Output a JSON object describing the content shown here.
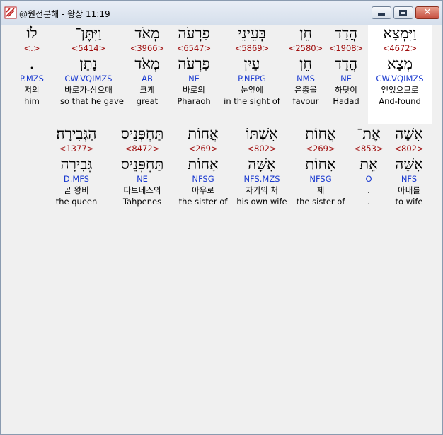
{
  "window": {
    "title": "@원전분해 - 왕상 11:19"
  },
  "lines": [
    {
      "words": [
        {
          "heb": "וַיִּמְצָא",
          "num": "<4672>",
          "root": "מְצָא",
          "gram": "CW.VQIMZS",
          "kor": "얻었으므로",
          "eng": "And-found",
          "highlight": true
        },
        {
          "heb": "הֲדַד",
          "num": "<1908>",
          "root": "הֲדַד",
          "gram": "NE",
          "kor": "하닷이",
          "eng": "Hadad"
        },
        {
          "heb": "חֵן",
          "num": "<2580>",
          "root": "חֵן",
          "gram": "NMS",
          "kor": "은총을",
          "eng": "favour"
        },
        {
          "heb": "בְּעֵינֵי",
          "num": "<5869>",
          "root": "עַיִן",
          "gram": "P.NFPG",
          "kor": "눈앞에",
          "eng": "in the sight of"
        },
        {
          "heb": "פַרְעֹה",
          "num": "<6547>",
          "root": "פַרְעֹה",
          "gram": "NE",
          "kor": "바로의",
          "eng": "Pharaoh"
        },
        {
          "heb": "מְאֹד",
          "num": "<3966>",
          "root": "מְאֹד",
          "gram": "AB",
          "kor": "크게",
          "eng": "great"
        },
        {
          "heb": "וַיִּתֶּן־",
          "num": "<5414>",
          "root": "נָתַן",
          "gram": "CW.VQIMZS",
          "kor": "바로가-삼으매",
          "eng": "so that he gave"
        },
        {
          "heb": "לוֹ",
          "num": "<.>",
          "root": ".",
          "gram": "P.MZS",
          "kor": "저의",
          "eng": "him"
        }
      ]
    },
    {
      "words": [
        {
          "heb": "אִשָּׁה",
          "num": "<802>",
          "root": "אִשָּׁה",
          "gram": "NFS",
          "kor": "아내를",
          "eng": "to wife"
        },
        {
          "heb": "אֶת־",
          "num": "<853>",
          "root": "אֵת",
          "gram": "O",
          "kor": ".",
          "eng": "."
        },
        {
          "heb": "אֲחוֹת",
          "num": "<269>",
          "root": "אָחוֹת",
          "gram": "NFSG",
          "kor": "제",
          "eng": "the sister of"
        },
        {
          "heb": "אִשְׁתּוֹ",
          "num": "<802>",
          "root": "אִשָּׁה",
          "gram": "NFS.MZS",
          "kor": "자기의 처",
          "eng": "his own wife"
        },
        {
          "heb": "אֲחוֹת",
          "num": "<269>",
          "root": "אָחוֹת",
          "gram": "NFSG",
          "kor": "아우로",
          "eng": "the sister of"
        },
        {
          "heb": "תַּחְפְּנֵיס",
          "num": "<8472>",
          "root": "תַּחְפְּנֵיס",
          "gram": "NE",
          "kor": "다브네스의",
          "eng": "Tahpenes"
        },
        {
          "heb": "הַגְּבִירָה׃",
          "num": "<1377>",
          "root": "גְּבִירָה",
          "gram": "D.MFS",
          "kor": "곧 왕비",
          "eng": "the queen"
        }
      ]
    }
  ]
}
